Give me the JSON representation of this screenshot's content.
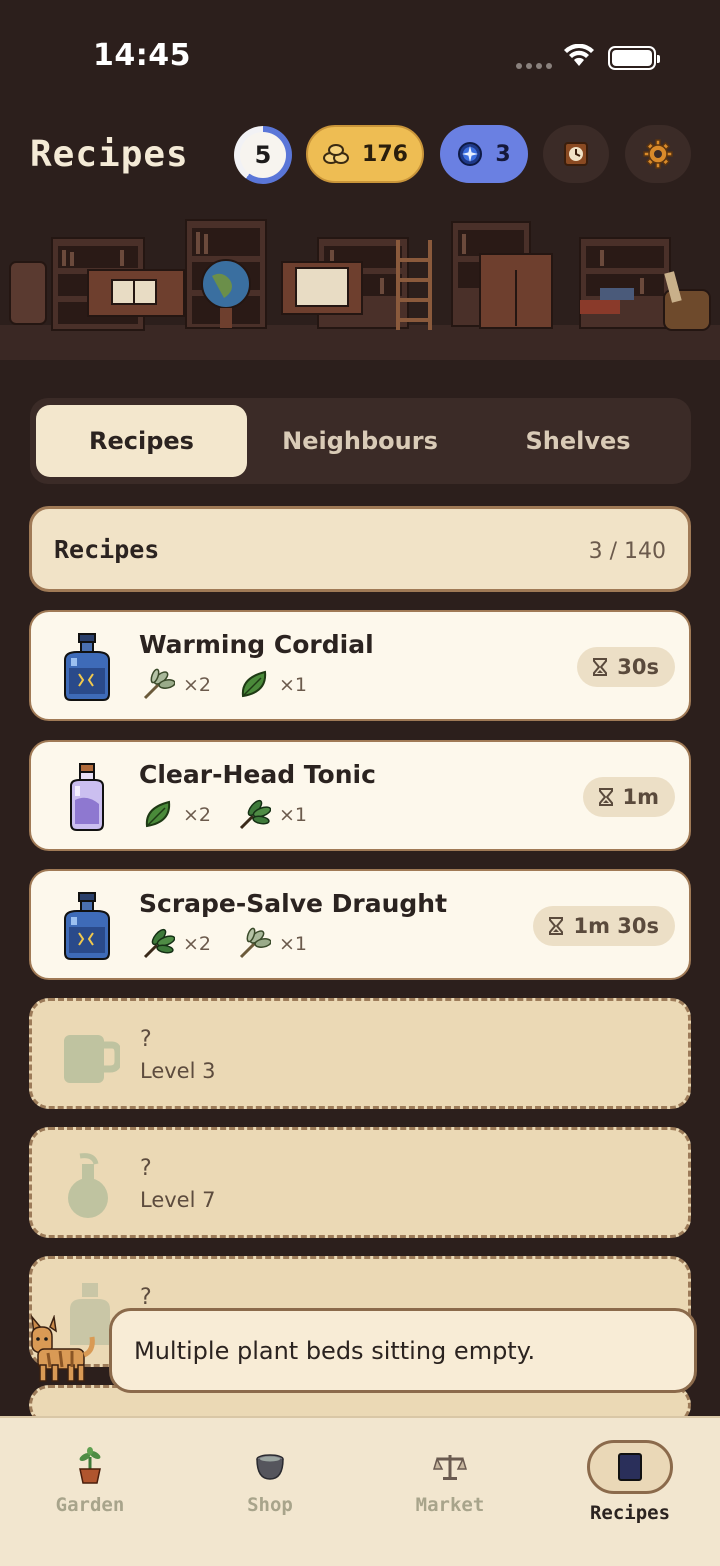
{
  "status_bar": {
    "time": "14:45"
  },
  "header": {
    "title": "Recipes",
    "level": "5",
    "level_progress": 0.6,
    "coins": "176",
    "gems": "3"
  },
  "tabs": [
    {
      "label": "Recipes",
      "active": true
    },
    {
      "label": "Neighbours",
      "active": false
    },
    {
      "label": "Shelves",
      "active": false
    }
  ],
  "section": {
    "title": "Recipes",
    "count": "3 / 140"
  },
  "recipes": [
    {
      "name": "Warming Cordial",
      "icon": "blue-bottle-icon",
      "ingredients": [
        {
          "icon": "sage-sprig-icon",
          "qty": "×2"
        },
        {
          "icon": "leaf-icon",
          "qty": "×1"
        }
      ],
      "time": "30s"
    },
    {
      "name": "Clear-Head Tonic",
      "icon": "purple-vial-icon",
      "ingredients": [
        {
          "icon": "leaf-icon",
          "qty": "×2"
        },
        {
          "icon": "herb-bundle-icon",
          "qty": "×1"
        }
      ],
      "time": "1m"
    },
    {
      "name": "Scrape-Salve Draught",
      "icon": "blue-bottle-icon",
      "ingredients": [
        {
          "icon": "herb-bundle-icon",
          "qty": "×2"
        },
        {
          "icon": "sage-sprig-icon",
          "qty": "×1"
        }
      ],
      "time": "1m 30s"
    }
  ],
  "locked": [
    {
      "q": "?",
      "level": "Level 3",
      "icon": "mug-icon"
    },
    {
      "q": "?",
      "level": "Level 7",
      "icon": "flask-icon"
    },
    {
      "q": "?",
      "level": "",
      "icon": "bottle-icon"
    }
  ],
  "toast": {
    "message": "Multiple plant beds sitting empty."
  },
  "nav": [
    {
      "label": "Garden",
      "icon": "plant-pot-icon"
    },
    {
      "label": "Shop",
      "icon": "cauldron-icon"
    },
    {
      "label": "Market",
      "icon": "scales-icon"
    },
    {
      "label": "Recipes",
      "icon": "recipe-book-icon",
      "active": true
    }
  ],
  "colors": {
    "background": "#2c1f1c",
    "card": "#fdf8ec",
    "coins": "#eebd53",
    "gems": "#6a80e2",
    "level_ring": "#5a76d8"
  }
}
